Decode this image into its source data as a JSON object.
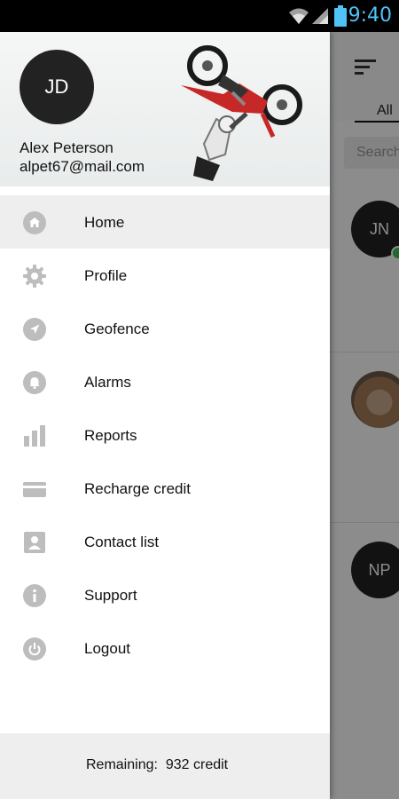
{
  "status_bar": {
    "time": "9:40",
    "icons": [
      "wifi-icon",
      "signal-icon",
      "battery-icon"
    ],
    "clock_color": "#4fc3f7"
  },
  "drawer": {
    "user": {
      "initials": "JD",
      "name": "Alex Peterson",
      "email": "alpet67@mail.com"
    },
    "menu": [
      {
        "label": "Home",
        "icon": "home-icon",
        "active": true
      },
      {
        "label": "Profile",
        "icon": "gear-icon"
      },
      {
        "label": "Geofence",
        "icon": "navigation-icon"
      },
      {
        "label": "Alarms",
        "icon": "bell-icon"
      },
      {
        "label": "Reports",
        "icon": "bar-chart-icon"
      },
      {
        "label": "Recharge credit",
        "icon": "credit-card-icon"
      },
      {
        "label": "Contact list",
        "icon": "contact-card-icon"
      },
      {
        "label": "Support",
        "icon": "info-icon"
      },
      {
        "label": "Logout",
        "icon": "power-icon"
      }
    ],
    "footer": {
      "remaining_label": "Remaining:",
      "credit_amount": "932",
      "credit_unit": "credit"
    }
  },
  "background": {
    "tab_all": "All",
    "search_placeholder": "Search",
    "contacts": [
      {
        "initials": "JN",
        "online": true
      },
      {
        "initials": "",
        "photo": true
      },
      {
        "initials": "NP",
        "online": false
      }
    ]
  },
  "colors": {
    "accent": "#4fc3f7",
    "online": "#3fbf5a",
    "active_item": "#eeeeee",
    "icon_gray": "#bdbdbd"
  }
}
